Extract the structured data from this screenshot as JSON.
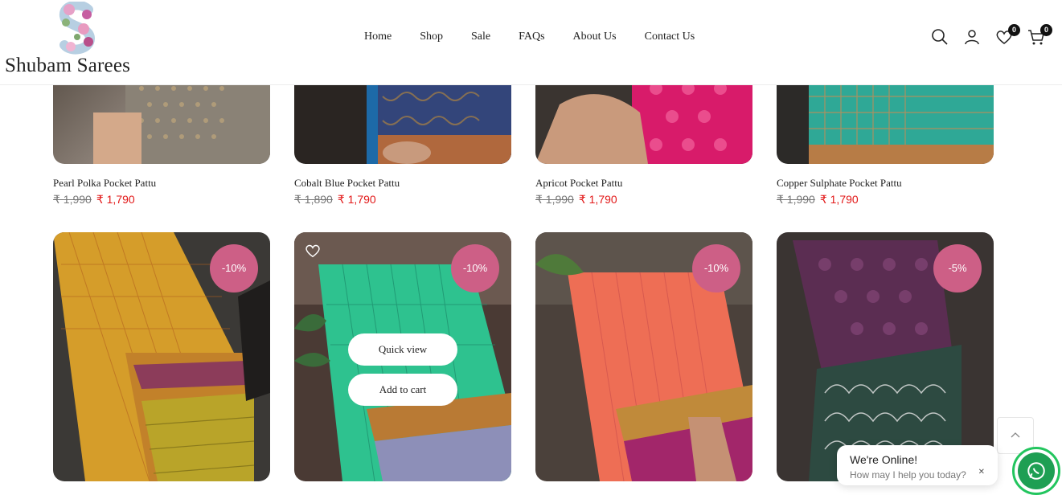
{
  "brand": {
    "name": "Shubam Sarees"
  },
  "nav": {
    "items": [
      "Home",
      "Shop",
      "Sale",
      "FAQs",
      "About Us",
      "Contact Us"
    ]
  },
  "header_icons": {
    "search": "search-icon",
    "account": "user-icon",
    "wishlist": "heart-icon",
    "wishlist_count": "0",
    "cart": "cart-icon",
    "cart_count": "0"
  },
  "products_row1": [
    {
      "title": "Pearl Polka Pocket Pattu",
      "old_price": "₹ 1,990",
      "price": "₹ 1,790"
    },
    {
      "title": "Cobalt Blue Pocket Pattu",
      "old_price": "₹ 1,890",
      "price": "₹ 1,790"
    },
    {
      "title": "Apricot Pocket Pattu",
      "old_price": "₹ 1,990",
      "price": "₹ 1,790"
    },
    {
      "title": "Copper Sulphate Pocket Pattu",
      "old_price": "₹ 1,990",
      "price": "₹ 1,790"
    }
  ],
  "products_row2": [
    {
      "badge": "-10%"
    },
    {
      "badge": "-10%",
      "quick_view": "Quick view",
      "add_to_cart": "Add to cart"
    },
    {
      "badge": "-10%"
    },
    {
      "badge": "-5%"
    }
  ],
  "chat": {
    "title": "We're Online!",
    "subtitle": "How may I help you today?"
  },
  "colors": {
    "badge": "#cd5f86",
    "sale_price": "#e21818",
    "whatsapp": "#1e9f53"
  }
}
